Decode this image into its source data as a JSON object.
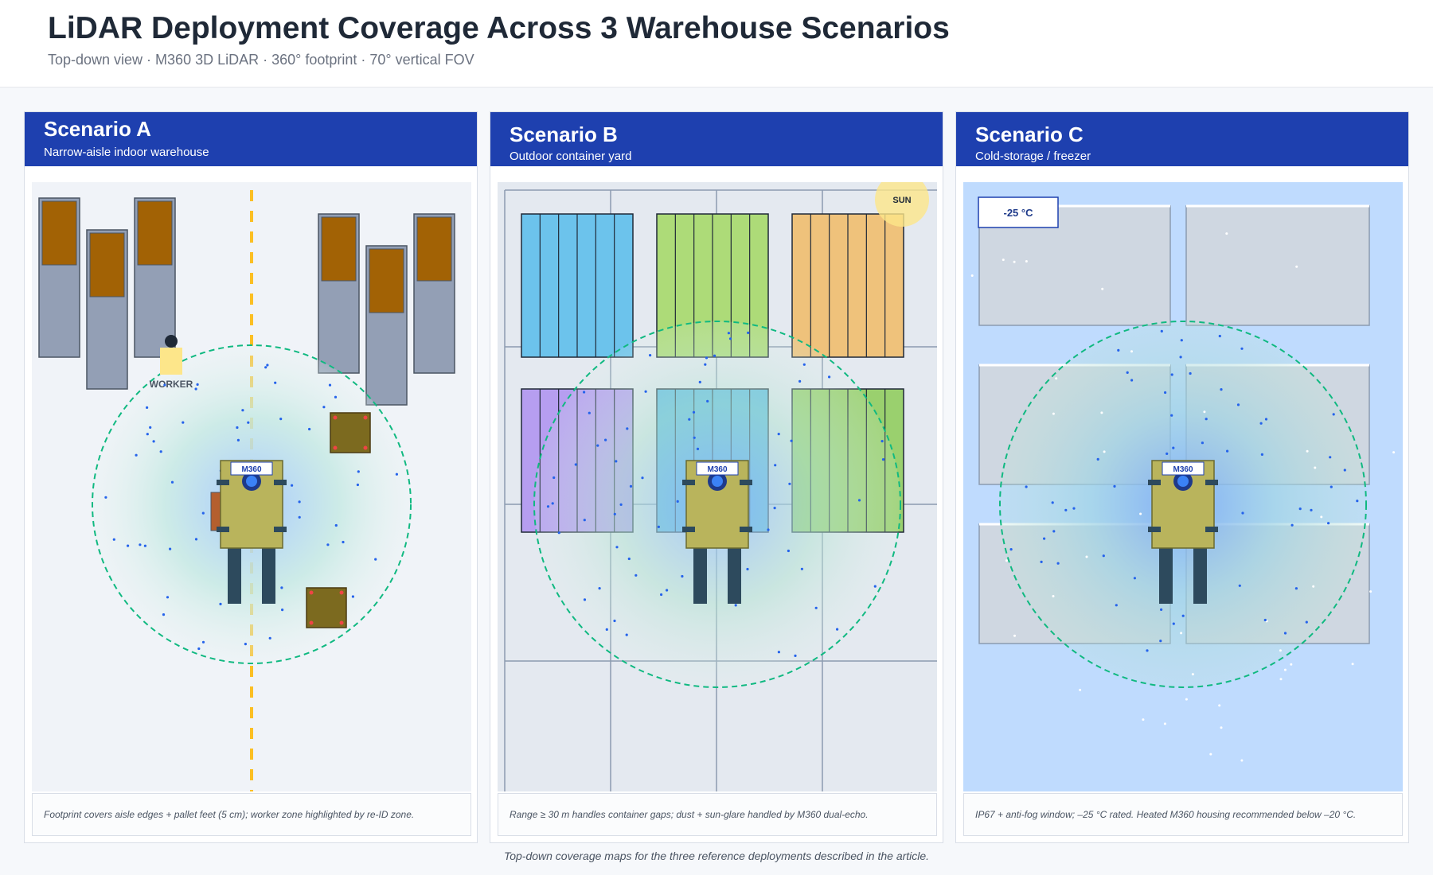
{
  "header": {
    "title": "LiDAR Deployment Coverage Across 3 Warehouse Scenarios",
    "subtitle": "Top-down view · M360 3D LiDAR · 360° footprint · 70° vertical FOV"
  },
  "scenarios": [
    {
      "title": "Scenario A",
      "description": "Narrow-aisle indoor warehouse",
      "device_label": "M360",
      "tags": {
        "worker": "WORKER"
      },
      "caption": "Footprint covers aisle edges + pallet feet (5 cm); worker zone highlighted by re-ID zone."
    },
    {
      "title": "Scenario B",
      "description": "Outdoor container yard",
      "device_label": "M360",
      "tags": {
        "sun": "SUN"
      },
      "caption": "Range ≥ 30 m handles container gaps; dust + sun-glare handled by M360 dual-echo."
    },
    {
      "title": "Scenario C",
      "description": "Cold-storage / freezer",
      "device_label": "M360",
      "tags": {
        "temperature": "-25 °C"
      },
      "caption": "IP67 + anti-fog window; –25 °C rated. Heated M360 housing recommended below –20 °C."
    }
  ],
  "figure_caption": "Top-down coverage maps for the three reference deployments described in the article.",
  "colors": {
    "header_blue": "#1e40af",
    "coverage_ring": "#10b981",
    "lidar_point": "#2563eb",
    "aisle_line": "#fbbf24",
    "robot_body": "#b9b45c",
    "container_blue": "#6cc3ec",
    "container_green": "#addb78",
    "container_orange": "#efc27b",
    "container_purple": "#b69ef0",
    "cold_floor": "#bfdbfe"
  }
}
